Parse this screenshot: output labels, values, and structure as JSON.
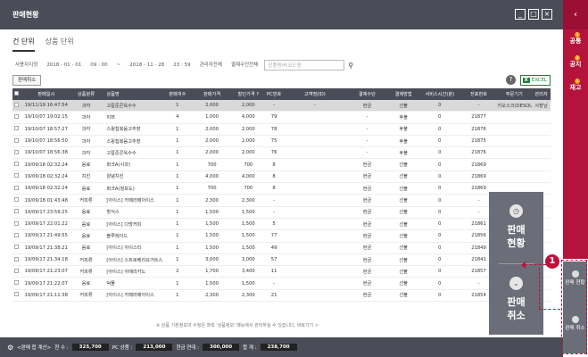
{
  "window": {
    "title": "판매현황",
    "buttons": [
      "_",
      "□",
      "×"
    ]
  },
  "right_nav": {
    "top_icon": "‹",
    "items": [
      {
        "label": "공통",
        "badge": "1"
      },
      {
        "label": "공지",
        "badge": "2"
      },
      {
        "label": "재고",
        "badge": "1"
      }
    ]
  },
  "tabs": [
    {
      "label": "건 단위"
    },
    {
      "label": "상품 단위"
    }
  ],
  "filters": {
    "period": "사용자지정",
    "date_from": "2018 - 01 - 01",
    "time_from": "09 : 00",
    "date_to": "2018 - 11 - 28",
    "time_to": "23 : 59",
    "option1": "관리자전체",
    "option2": "결제수단전체",
    "search_placeholder": "상품명/바코드명"
  },
  "toolbar": {
    "cancel_label": "판매취소",
    "excel_label": "EXCEL",
    "help": "?"
  },
  "table": {
    "headers": [
      "",
      "판매일시",
      "상품분류",
      "상품명",
      "판매개수",
      "판매가격",
      "할인가격 ?",
      "PC번호",
      "고객명(ID)",
      "결제수단",
      "결제방법",
      "서비스시간(분)",
      "전표번호",
      "주문기기",
      "관리자"
    ],
    "rows": [
      [
        "",
        "19/11/19 16:47:54",
        "과자",
        "고칼준콘옥수수",
        "1",
        "2,000",
        "2,000",
        "-",
        "-",
        "현금",
        "선불",
        "0",
        "-",
        "키오스크(DESQUE...",
        "사장님"
      ],
      [
        "",
        "19/10/07 19:02:15",
        "과자",
        "미쯔",
        "4",
        "1,000",
        "4,000",
        "79",
        "",
        "-",
        "후불",
        "0",
        "21877",
        "",
        ""
      ],
      [
        "",
        "19/10/07 18:57:27",
        "과자",
        "스윙칩볶음고추장",
        "1",
        "2,000",
        "2,000",
        "78",
        "",
        "-",
        "후불",
        "0",
        "21876",
        "",
        ""
      ],
      [
        "",
        "19/10/07 18:56:50",
        "과자",
        "스윙칩볶음고추장",
        "1",
        "2,000",
        "2,000",
        "75",
        "",
        "-",
        "후불",
        "0",
        "21875",
        "",
        ""
      ],
      [
        "",
        "19/10/07 18:56:38",
        "과자",
        "고칼준콘옥수수",
        "1",
        "2,000",
        "2,000",
        "76",
        "",
        "-",
        "후불",
        "0",
        "21876",
        "",
        ""
      ],
      [
        "",
        "19/09/18 02:32:24",
        "음료",
        "파크A(사과)",
        "1",
        "700",
        "700",
        "8",
        "",
        "현금",
        "선불",
        "0",
        "21869",
        "",
        ""
      ],
      [
        "",
        "19/09/18 02:32:24",
        "치킨",
        "양념치킨",
        "1",
        "4,000",
        "4,000",
        "8",
        "",
        "현금",
        "선불",
        "0",
        "21869",
        "",
        ""
      ],
      [
        "",
        "19/09/18 02:32:24",
        "음료",
        "파크A(청포도)",
        "1",
        "700",
        "700",
        "8",
        "",
        "현금",
        "선불",
        "0",
        "21869",
        "",
        ""
      ],
      [
        "",
        "19/09/18 01:43:48",
        "커피류",
        "[아이스] 카페라떼아이스",
        "1",
        "2,300",
        "2,300",
        "-",
        "",
        "현금",
        "선불",
        "0",
        "-",
        "",
        ""
      ],
      [
        "",
        "19/09/17 23:59:25",
        "음료",
        "핫식스",
        "1",
        "1,500",
        "1,500",
        "-",
        "",
        "현금",
        "선불",
        "0",
        "-",
        "",
        ""
      ],
      [
        "",
        "19/09/17 22:01:22",
        "음료",
        "[아이스] 다방커피",
        "1",
        "1,500",
        "1,500",
        "5",
        "",
        "현금",
        "선불",
        "0",
        "21861",
        "",
        ""
      ],
      [
        "",
        "19/09/17 21:49:55",
        "음료",
        "블루레이드",
        "1",
        "1,500",
        "1,500",
        "77",
        "",
        "현금",
        "선불",
        "0",
        "21856",
        "",
        ""
      ],
      [
        "",
        "19/09/17 21:38:21",
        "음료",
        "[아이스] 아이스티",
        "1",
        "1,500",
        "1,500",
        "49",
        "",
        "현금",
        "선불",
        "0",
        "21849",
        "",
        ""
      ],
      [
        "",
        "19/09/17 21:34:18",
        "커피류",
        "[아이스] 스트로베리요거트스...",
        "1",
        "3,000",
        "3,000",
        "57",
        "",
        "현금",
        "선불",
        "0",
        "21841",
        "",
        ""
      ],
      [
        "",
        "19/09/17 21:23:07",
        "커피류",
        "[아이스] 아메리카노",
        "2",
        "1,700",
        "3,400",
        "11",
        "",
        "현금",
        "선불",
        "0",
        "21857",
        "",
        ""
      ],
      [
        "",
        "19/09/17 21:22:07",
        "음료",
        "덕풀",
        "1",
        "1,500",
        "1,500",
        "-",
        "",
        "현금",
        "선불",
        "0",
        "-",
        "",
        ""
      ],
      [
        "",
        "19/09/17 21:11:38",
        "커피류",
        "[아이스] 카페라떼아이스",
        "1",
        "2,300",
        "2,300",
        "21",
        "",
        "현금",
        "선불",
        "0",
        "21854",
        "",
        ""
      ]
    ]
  },
  "notice": "※ 상품 기본정보의 수정은 좌측 '상품정보' 메뉴에서 관리하실 수 있습니다.  바로가기 >",
  "footer": {
    "label": "<판매 합 계산>",
    "cash_label": "현 수 :",
    "cash_value": "325,700",
    "pc_label": "PC 상품 :",
    "pc_value": "213,000",
    "etc_label": "현금 연대 :",
    "etc_value": "300,000",
    "total_label": "합 계 :",
    "total_value": "238,700"
  },
  "overlay": {
    "item1": "판매\n현황",
    "item2": "판매\n취소",
    "badge": "1"
  },
  "side_buttons": [
    {
      "label": "판매 현황"
    },
    {
      "label": "판매 취소"
    }
  ],
  "colors": {
    "header_bg": "#4a4d57",
    "accent": "#b4133c",
    "badge": "#c0103a"
  }
}
